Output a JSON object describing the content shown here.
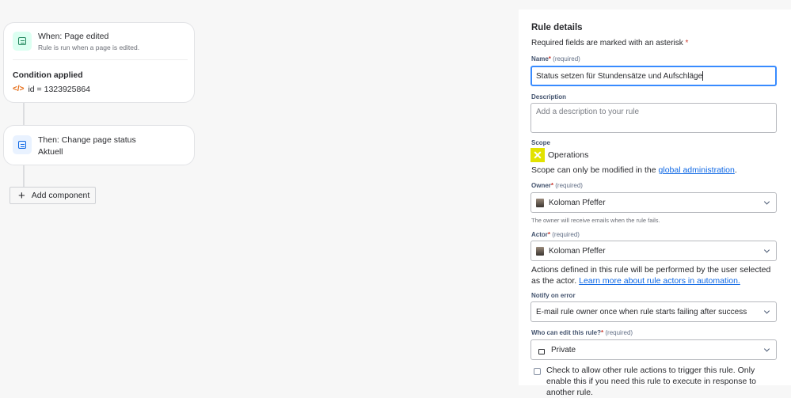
{
  "flow": {
    "trigger": {
      "title": "When: Page edited",
      "subtitle": "Rule is run when a page is edited.",
      "condition_heading": "Condition applied",
      "condition": "id = 1323925864"
    },
    "action": {
      "title": "Then: Change page status",
      "value": "Aktuell"
    },
    "add_component": "Add component"
  },
  "panel": {
    "title": "Rule details",
    "required_note": "Required fields are marked with an asterisk",
    "asterisk": "*",
    "required": "(required)",
    "name": {
      "label": "Name",
      "value": "Status setzen für Stundensätze und Aufschläge"
    },
    "description": {
      "label": "Description",
      "placeholder": "Add a description to your rule"
    },
    "scope": {
      "label": "Scope",
      "value": "Operations",
      "note": "Scope can only be modified in the",
      "link": "global administration",
      "end": "."
    },
    "owner": {
      "label": "Owner",
      "value": "Koloman Pfeffer",
      "help": "The owner will receive emails when the rule fails."
    },
    "actor": {
      "label": "Actor",
      "value": "Koloman Pfeffer",
      "help": "Actions defined in this rule will be performed by the user selected as the actor.",
      "link": "Learn more about rule actors in automation."
    },
    "notify": {
      "label": "Notify on error",
      "value": "E-mail rule owner once when rule starts failing after success"
    },
    "who_edit": {
      "label": "Who can edit this rule?",
      "value": "Private"
    },
    "allow_trigger": {
      "label": "Check to allow other rule actions to trigger this rule. Only enable this if you need this rule to execute in response to another rule.",
      "checked": false
    }
  }
}
